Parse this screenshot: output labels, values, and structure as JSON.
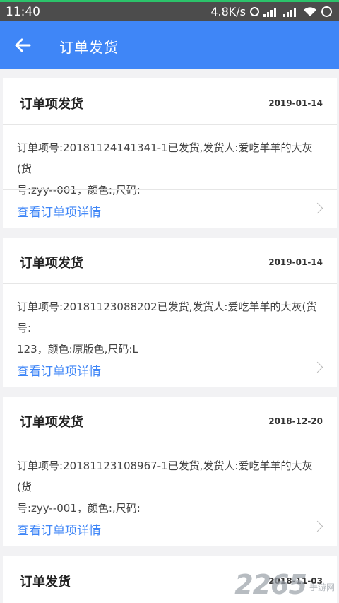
{
  "status": {
    "time": "11:40",
    "network": "4.8K/s"
  },
  "app_bar": {
    "title": "订单发货"
  },
  "cards": [
    {
      "title": "订单项发货",
      "date": "2019-01-14",
      "body_line1": "订单项号:20181124141341-1已发货,发货人:爱吃羊羊的大灰(货",
      "body_line2": "号:zyy--001，颜色:,尺码:",
      "link": "查看订单项详情"
    },
    {
      "title": "订单项发货",
      "date": "2019-01-14",
      "body_line1": "订单项号:20181123088202已发货,发货人:爱吃羊羊的大灰(货号:",
      "body_line2": "123，颜色:原版色,尺码:L",
      "link": "查看订单项详情"
    },
    {
      "title": "订单项发货",
      "date": "2018-12-20",
      "body_line1": "订单项号:20181123108967-1已发货,发货人:爱吃羊羊的大灰(货",
      "body_line2": "号:zyy--001，颜色:,尺码:",
      "link": "查看订单项详情"
    },
    {
      "title": "订单发货",
      "date": "2018-11-03"
    }
  ],
  "watermark": {
    "number": "2265",
    "text": "手游网"
  }
}
